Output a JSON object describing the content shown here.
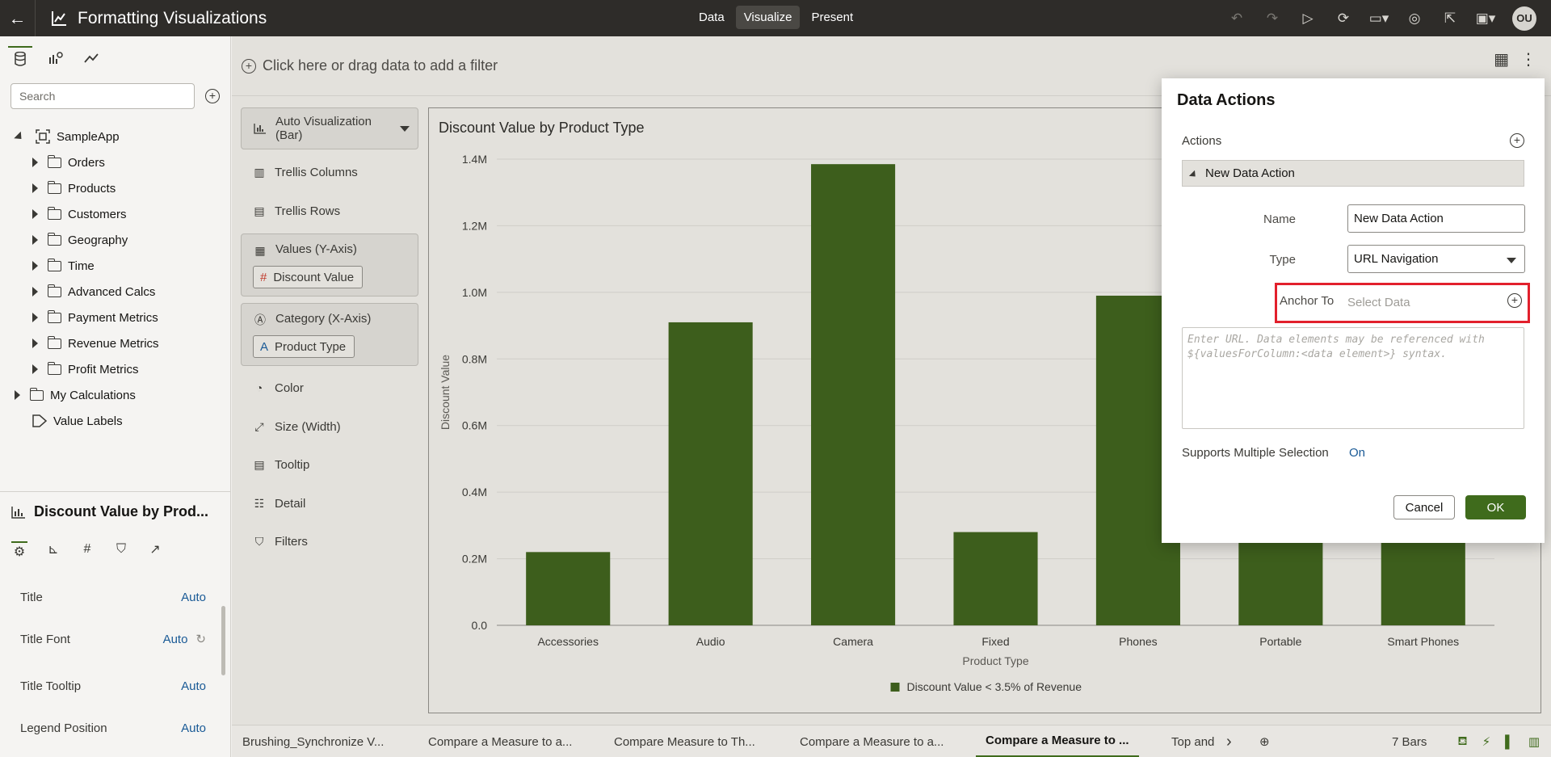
{
  "app": {
    "title": "Formatting Visualizations",
    "modes": [
      "Data",
      "Visualize",
      "Present"
    ],
    "active_mode": "Visualize",
    "avatar": "OU"
  },
  "left_panel": {
    "search_placeholder": "Search",
    "tree": [
      {
        "label": "SampleApp",
        "type": "subject-area",
        "expanded": true
      },
      {
        "label": "Orders",
        "type": "folder"
      },
      {
        "label": "Products",
        "type": "folder"
      },
      {
        "label": "Customers",
        "type": "folder"
      },
      {
        "label": "Geography",
        "type": "folder"
      },
      {
        "label": "Time",
        "type": "folder"
      },
      {
        "label": "Advanced Calcs",
        "type": "folder"
      },
      {
        "label": "Payment Metrics",
        "type": "folder"
      },
      {
        "label": "Revenue Metrics",
        "type": "folder"
      },
      {
        "label": "Profit Metrics",
        "type": "folder"
      },
      {
        "label": "My Calculations",
        "type": "folder"
      },
      {
        "label": "Value Labels",
        "type": "tag"
      }
    ],
    "viz_title": "Discount Value by Prod...",
    "properties": [
      {
        "label": "Title",
        "value": "Auto"
      },
      {
        "label": "Title Font",
        "value": "Auto"
      },
      {
        "label": "Title Tooltip",
        "value": "Auto"
      },
      {
        "label": "Legend Position",
        "value": "Auto"
      }
    ]
  },
  "canvas": {
    "filter_hint": "Click here or drag data to add a filter"
  },
  "grammar": {
    "viz_type_line1": "Auto Visualization",
    "viz_type_line2": "(Bar)",
    "trellis_columns": "Trellis Columns",
    "trellis_rows": "Trellis Rows",
    "values_label": "Values (Y-Axis)",
    "values_pill": "Discount Value",
    "category_label": "Category (X-Axis)",
    "category_pill": "Product Type",
    "color": "Color",
    "size": "Size (Width)",
    "tooltip": "Tooltip",
    "detail": "Detail",
    "filters": "Filters"
  },
  "chart_data": {
    "type": "bar",
    "title": "Discount Value by Product Type",
    "xlabel": "Product Type",
    "ylabel": "Discount Value",
    "categories": [
      "Accessories",
      "Audio",
      "Camera",
      "Fixed",
      "Phones",
      "Portable",
      "Smart Phones"
    ],
    "series": [
      {
        "name": "Discount Value < 3.5% of Revenue",
        "values": [
          220000,
          910000,
          1385000,
          280000,
          990000,
          690000,
          630000
        ]
      }
    ],
    "y_ticks": [
      "0.0",
      "0.2M",
      "0.4M",
      "0.6M",
      "0.8M",
      "1.0M",
      "1.2M",
      "1.4M"
    ],
    "ylim": [
      0,
      1400000
    ],
    "grid": true,
    "legend_position": "bottom",
    "bar_color": "#3d5e1c"
  },
  "bottom_tabs": {
    "tabs": [
      "Brushing_Synchronize V...",
      "Compare a Measure to a...",
      "Compare Measure to Th...",
      "Compare a Measure to a...",
      "Compare a Measure to ...",
      "Top and"
    ],
    "active_index": 4,
    "bar_count": "7 Bars"
  },
  "dialog": {
    "title": "Data Actions",
    "actions_label": "Actions",
    "item_label": "New Data Action",
    "name_label": "Name",
    "name_value": "New Data Action",
    "type_label": "Type",
    "type_value": "URL Navigation",
    "anchor_label": "Anchor To",
    "anchor_placeholder": "Select Data",
    "url_placeholder_line1": "Enter URL. Data elements may be referenced with",
    "url_placeholder_line2": "${valuesForColumn:<data element>} syntax.",
    "multi_label": "Supports Multiple Selection",
    "multi_value": "On",
    "cancel_label": "Cancel",
    "ok_label": "OK"
  }
}
